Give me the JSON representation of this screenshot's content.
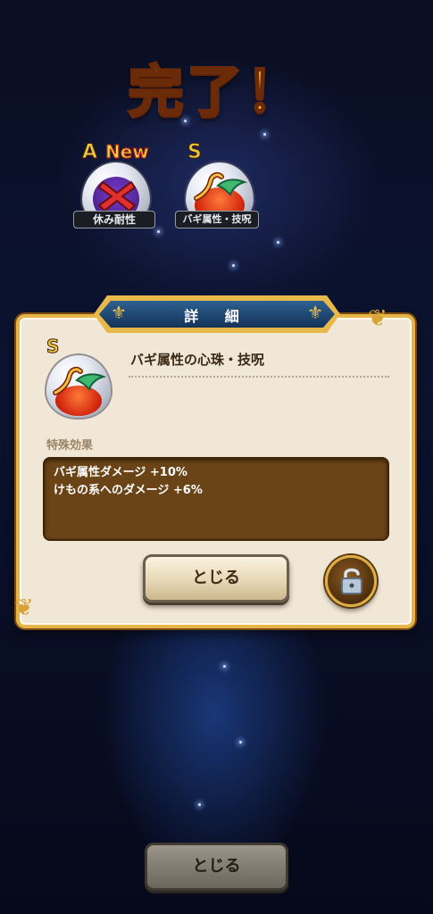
{
  "screen": {
    "title": "完了！"
  },
  "orbs": [
    {
      "grade": "A",
      "new_badge": "New",
      "label": "休み耐性",
      "icon": "cross-icon",
      "color": "#7a3bd0"
    },
    {
      "grade": "S",
      "label": "バギ属性・技呪",
      "icon": "whirlwind-icon",
      "color": "#e03a12"
    }
  ],
  "detail_dialog": {
    "header": "詳 細",
    "item": {
      "grade": "S",
      "name": "バギ属性の心珠・技呪",
      "icon": "whirlwind-icon"
    },
    "effect_heading": "特殊効果",
    "effects": [
      "バギ属性ダメージ +10%",
      "けもの系へのダメージ +6%"
    ],
    "close_label": "とじる",
    "lock_icon": "unlock-icon"
  },
  "footer": {
    "close_label": "とじる"
  },
  "colors": {
    "frame_gold": "#e6b448",
    "panel_bg": "#f1e7d6",
    "effect_box": "#6a4417",
    "header_blue": "#1f4a78"
  }
}
